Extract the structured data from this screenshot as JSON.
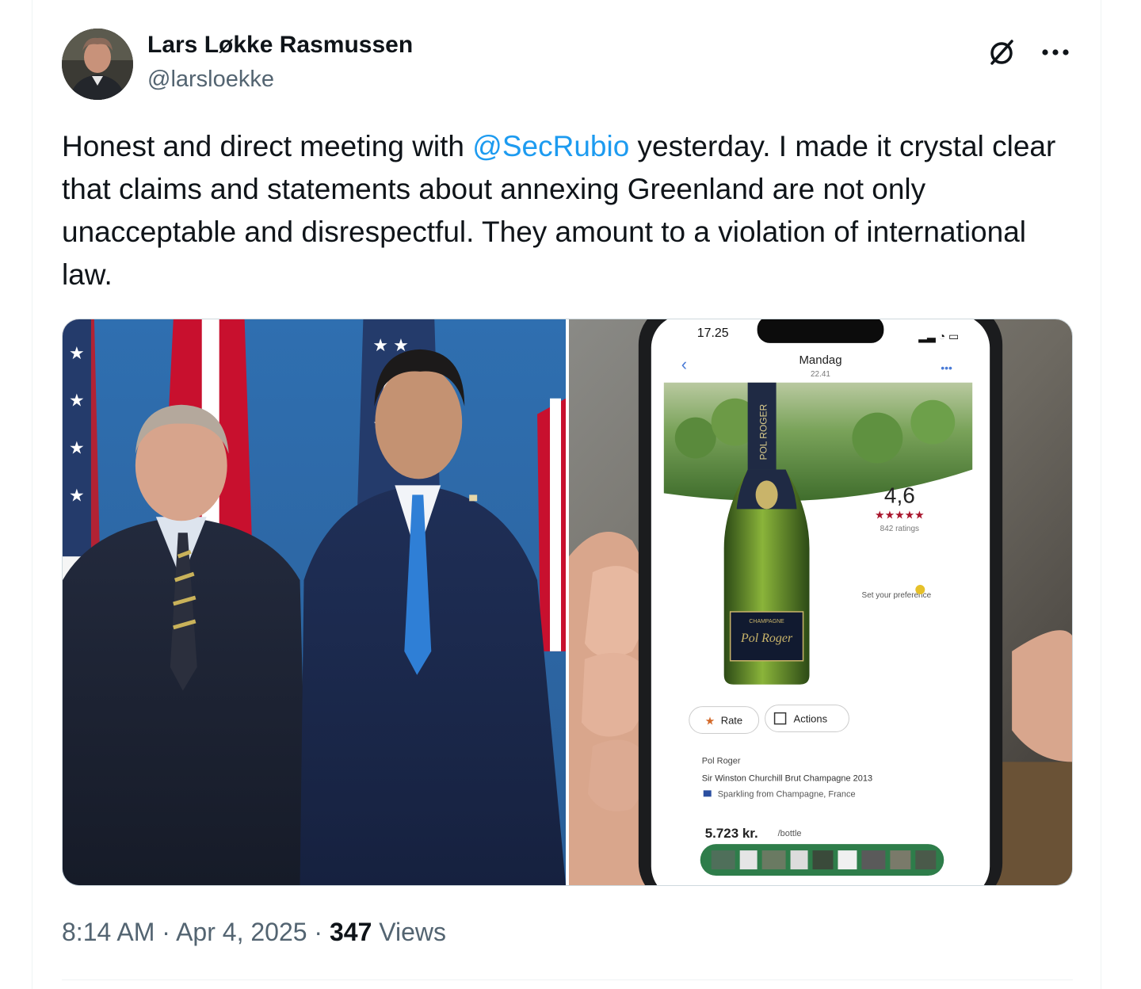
{
  "author": {
    "name": "Lars Løkke Rasmussen",
    "handle": "@larsloekke"
  },
  "tweet": {
    "text_before": "Honest and direct meeting with ",
    "mention": "@SecRubio",
    "text_after": " yesterday. I made it crystal clear that claims and statements about annexing Greenland are not only unacceptable and disrespectful. They amount to a violation of international law."
  },
  "media": {
    "photo_left_icon": "photo",
    "photo_right_icon": "photo",
    "phone_screen": {
      "time": "17.25",
      "header_title": "Mandag",
      "header_sub": "22.41",
      "rating": "4,6",
      "stars": "★★★★★",
      "ratings_count": "842 ratings",
      "preference": "Set your preference",
      "rate_label": "Rate",
      "actions_label": "Actions",
      "winery": "Pol Roger",
      "wine_name": "Sir Winston Churchill Brut Champagne 2013",
      "region": "Sparkling from Champagne, France",
      "price": "5.723 kr.",
      "price_unit": "/bottle",
      "label_text": "Pol Roger",
      "neck_text": "POL ROGER",
      "label_small": "CHAMPAGNE"
    }
  },
  "footer": {
    "time": "8:14 AM",
    "sep1": " · ",
    "date": "Apr 4, 2025",
    "sep2": " · ",
    "views_count": "347",
    "views_label": " Views"
  },
  "colors": {
    "accent": "#1d9bf0",
    "text": "#0f1419",
    "muted": "#536471"
  }
}
